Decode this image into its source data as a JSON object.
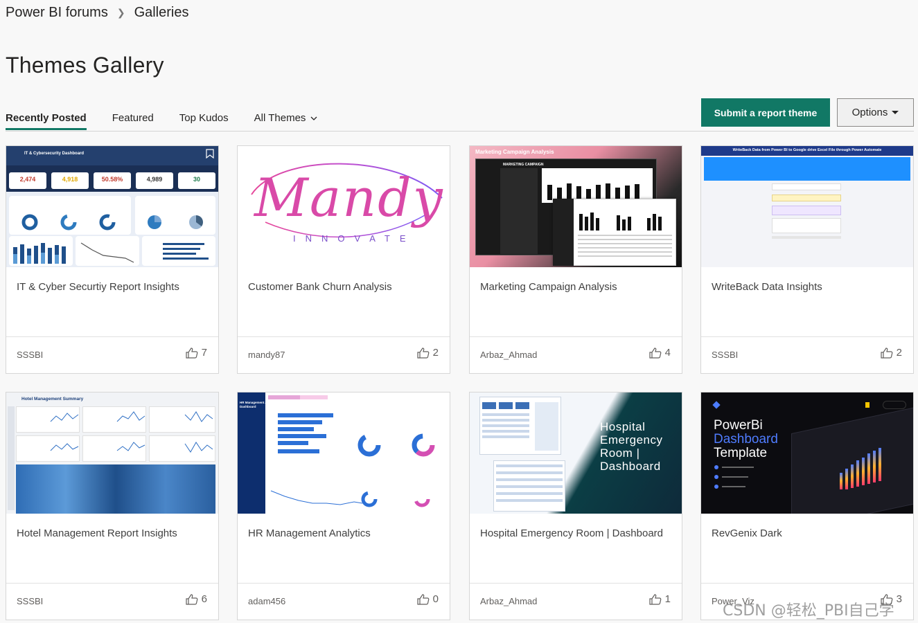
{
  "breadcrumb": {
    "home": "Power BI forums",
    "current": "Galleries"
  },
  "page": {
    "title": "Themes Gallery"
  },
  "tabs": [
    {
      "label": "Recently Posted"
    },
    {
      "label": "Featured"
    },
    {
      "label": "Top Kudos"
    },
    {
      "label": "All Themes"
    }
  ],
  "actions": {
    "submit_label": "Submit a report theme",
    "options_label": "Options"
  },
  "cards": [
    {
      "title": "IT & Cyber Securtiy Report Insights",
      "author": "SSSBI",
      "kudos": "7",
      "thumb": {
        "header": "IT & Cybersecurity Dashboard",
        "kpis": [
          "2,474",
          "4,918",
          "50.58%",
          "4,989",
          "30"
        ]
      }
    },
    {
      "title": "Customer Bank Churn Analysis",
      "author": "mandy87",
      "kudos": "2",
      "thumb": {
        "logo": "Mandy",
        "tagline": "INNOVATE"
      }
    },
    {
      "title": "Marketing Campaign Analysis",
      "author": "Arbaz_Ahmad",
      "kudos": "4",
      "thumb": {
        "header": "Marketing Campaign Analysis",
        "panel": "MARKETING CAMPAIGN"
      }
    },
    {
      "title": "WriteBack Data Insights",
      "author": "SSSBI",
      "kudos": "2",
      "thumb": {
        "header": "WriteBack Data from Power BI to Google drive Excel File through Power Automate"
      }
    },
    {
      "title": "Hotel Management Report Insights",
      "author": "SSSBI",
      "kudos": "6",
      "thumb": {
        "header": "Hotel Management Summary"
      }
    },
    {
      "title": "HR Management Analytics",
      "author": "adam456",
      "kudos": "0",
      "thumb": {
        "header": "HR Management Analytic Dashboard"
      }
    },
    {
      "title": "Hospital Emergency Room | Dashboard",
      "author": "Arbaz_Ahmad",
      "kudos": "1",
      "thumb": {
        "line1": "Hospital",
        "line2": "Emergency",
        "line3": "Room |",
        "line4": "Dashboard"
      }
    },
    {
      "title": "RevGenix Dark",
      "author": "Power_Viz",
      "kudos": "3",
      "thumb": {
        "line1": "PowerBi",
        "line2": "Dashboard",
        "line3": "Template"
      }
    }
  ],
  "watermark": "CSDN @轻松_PBI自己学",
  "colors": {
    "accent": "#117865",
    "background": "#f8f8f8"
  }
}
